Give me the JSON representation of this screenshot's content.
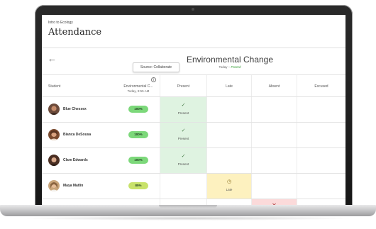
{
  "course_name": "Intro to Ecology",
  "page_title": "Attendance",
  "tooltip_text": "Source: Collaborate",
  "event": {
    "title": "Environmental Change",
    "date_label": "Today",
    "separator": " – ",
    "status": "Posted"
  },
  "table": {
    "headers": {
      "student": "Student",
      "metric": "Environmental C...",
      "metric_sub": "Today, 9:55 AM",
      "present": "Present",
      "late": "Late",
      "absent": "Absent",
      "excused": "Excused"
    },
    "rows": [
      {
        "name": "Blue Chessex",
        "percent": "100%",
        "status": "present",
        "mark_label": "Present"
      },
      {
        "name": "Bianca DeSousa",
        "percent": "100%",
        "status": "present",
        "mark_label": "Present"
      },
      {
        "name": "Clare Edwards",
        "percent": "100%",
        "status": "present",
        "mark_label": "Present"
      },
      {
        "name": "Maya Matlin",
        "percent": "85%",
        "status": "late",
        "mark_label": "Late"
      }
    ]
  },
  "icons": {
    "back": "arrow-left-icon",
    "info": "info-icon",
    "check": "check-icon",
    "clock": "clock-icon",
    "close": "x-icon"
  },
  "colors": {
    "present_bg": "#dff3e1",
    "late_bg": "#fdf1bf",
    "absent_bg": "#fbdada",
    "pill_green": "#7cd87a",
    "pill_yellow": "#c8e26a",
    "pill_red": "#e04747",
    "posted": "#3aa03a"
  }
}
